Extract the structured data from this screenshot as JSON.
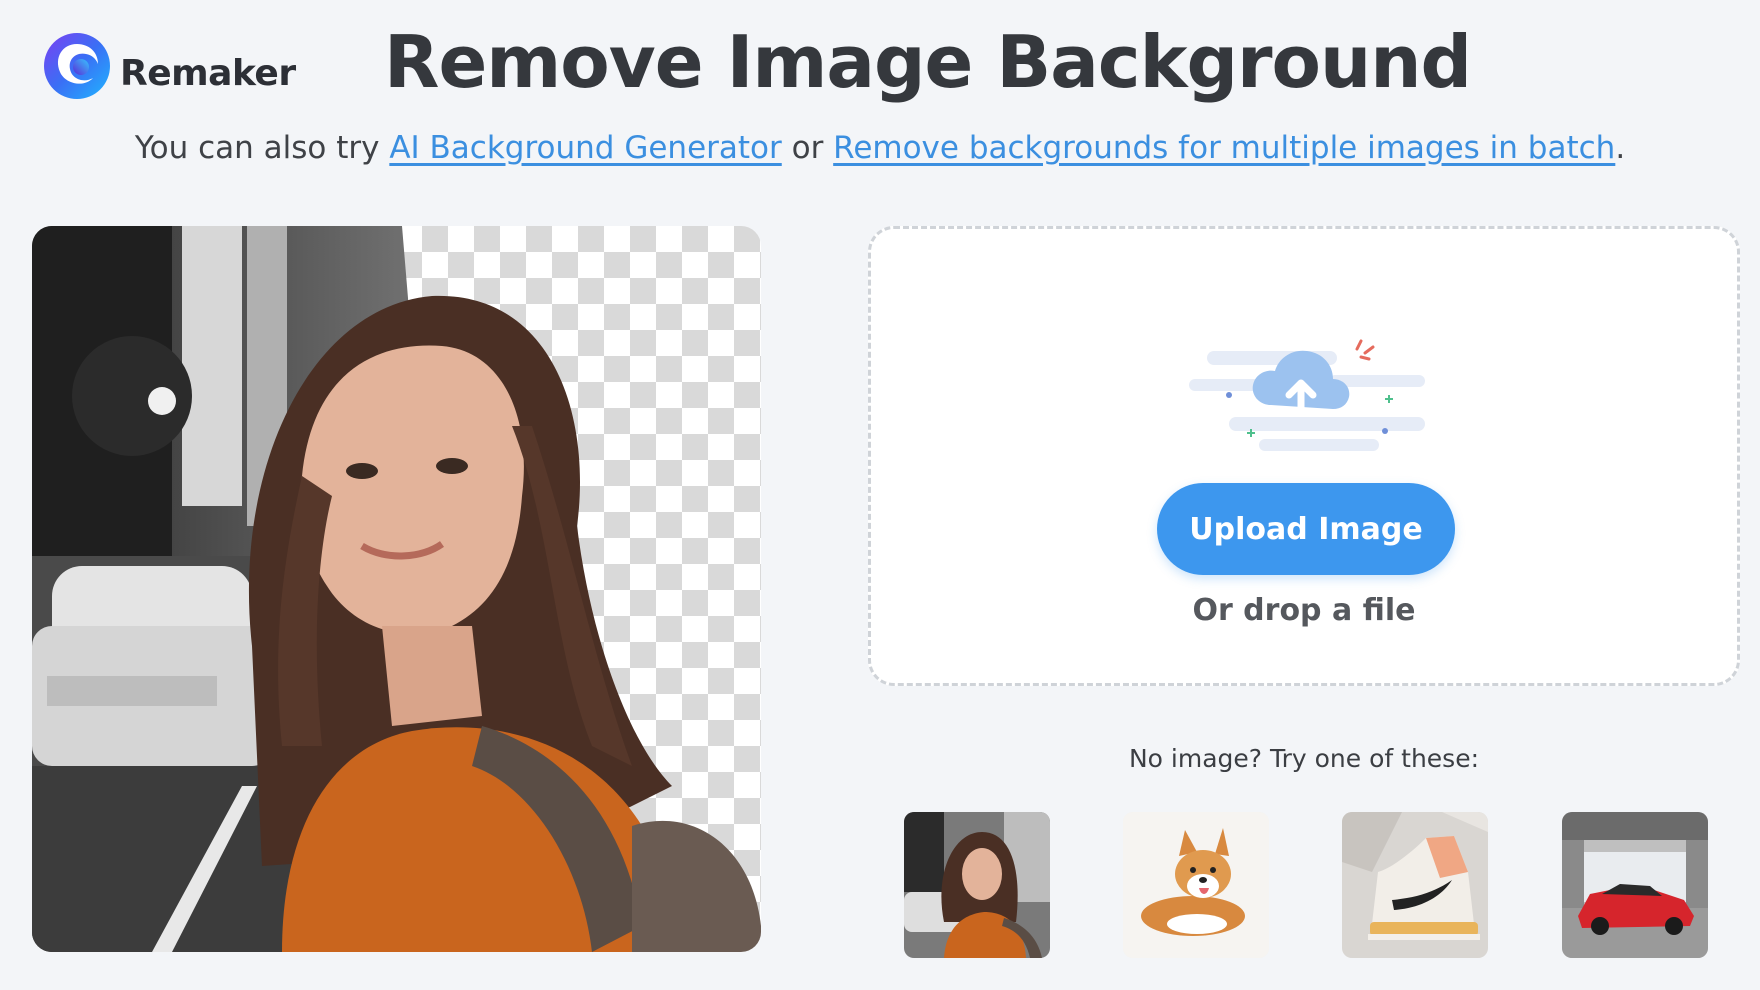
{
  "brand": {
    "name": "Remaker",
    "logo_icon": "remaker-swirl-logo"
  },
  "title": "Remove Image Background",
  "subtitle": {
    "prefix": "You can also try ",
    "link1": "AI Background Generator",
    "middle": " or ",
    "link2": "Remove backgrounds for multiple images in batch",
    "suffix": "."
  },
  "upload": {
    "icon": "cloud-upload-icon",
    "button_label": "Upload Image",
    "hint": "Or drop a file"
  },
  "samples": {
    "label": "No image? Try one of these:",
    "items": [
      {
        "name": "woman-with-backpack-photo"
      },
      {
        "name": "corgi-dog-photo"
      },
      {
        "name": "sneaker-photo"
      },
      {
        "name": "red-car-photo"
      }
    ]
  },
  "colors": {
    "accent": "#3d97ee",
    "link": "#3b8fe0",
    "background": "#f3f5f8"
  }
}
